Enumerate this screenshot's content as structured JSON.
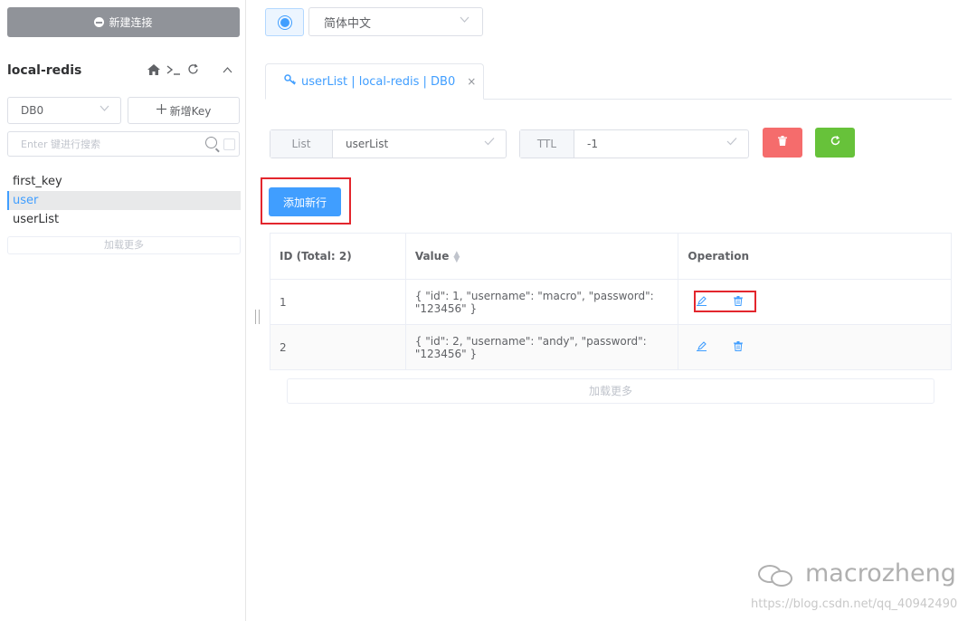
{
  "sidebar": {
    "new_connection": "新建连接",
    "connection_name": "local-redis",
    "db_select": "DB0",
    "new_key": "新增Key",
    "search_placeholder": "Enter 键进行搜索",
    "keys": [
      "first_key",
      "user",
      "userList"
    ],
    "active_key": "user",
    "load_more": "加载更多"
  },
  "topbar": {
    "language": "简体中文"
  },
  "tab": {
    "label": "userList | local-redis | DB0",
    "close": "×"
  },
  "key_detail": {
    "type_label": "List",
    "key_name": "userList",
    "ttl_label": "TTL",
    "ttl_value": "-1",
    "add_row": "添加新行"
  },
  "table": {
    "headers": [
      "ID (Total: 2)",
      "Value",
      "Operation"
    ],
    "rows": [
      {
        "id": "1",
        "value": "{ \"id\": 1, \"username\": \"macro\", \"password\": \"123456\" }"
      },
      {
        "id": "2",
        "value": "{ \"id\": 2, \"username\": \"andy\", \"password\": \"123456\" }"
      }
    ],
    "load_more": "加载更多"
  },
  "watermark": {
    "brand": "macrozheng",
    "url": "https://blog.csdn.net/qq_40942490"
  },
  "colors": {
    "primary": "#409eff",
    "danger": "#f56c6c",
    "success": "#67c23a",
    "highlight_border": "#e3262d"
  }
}
